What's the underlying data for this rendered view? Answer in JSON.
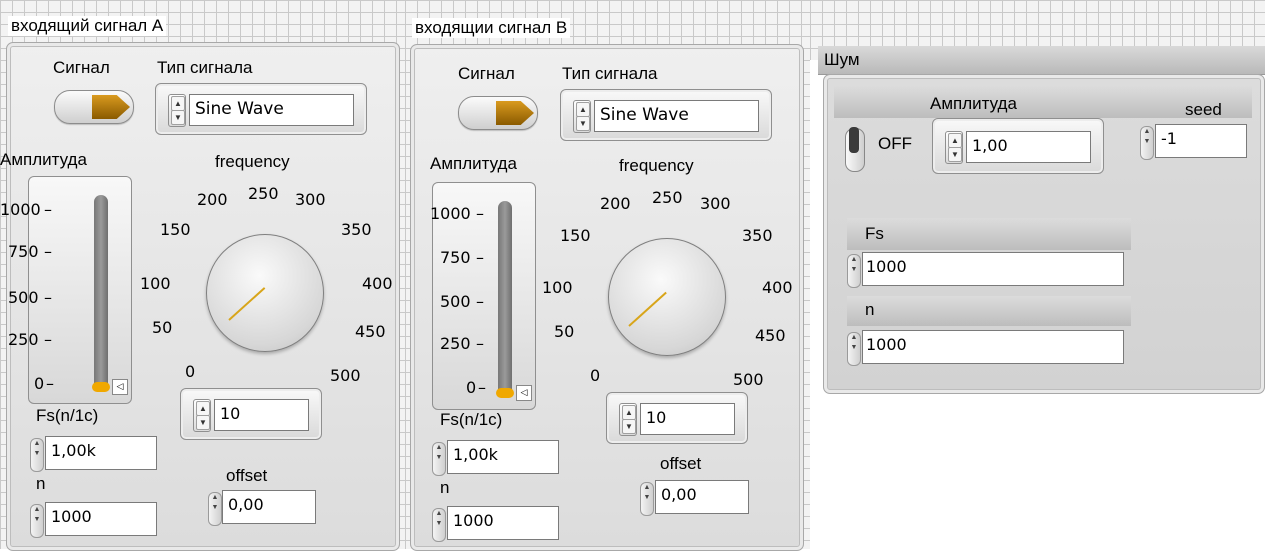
{
  "panel_a": {
    "title": "входящий сигнал A",
    "signal_label": "Сигнал",
    "signal_type_label": "Тип сигнала",
    "signal_type_value": "Sine Wave",
    "amplitude_label": "Амплитуда",
    "amplitude_ticks": [
      "1000",
      "750",
      "500",
      "250",
      "0"
    ],
    "amplitude_level": 0,
    "frequency_label": "frequency",
    "frequency_ticks": [
      "0",
      "50",
      "100",
      "150",
      "200",
      "250",
      "300",
      "350",
      "400",
      "450",
      "500"
    ],
    "frequency_value": "10",
    "fs_label": "Fs(n/1c)",
    "fs_value": "1,00k",
    "n_label": "n",
    "n_value": "1000",
    "offset_label": "offset",
    "offset_value": "0,00"
  },
  "panel_b": {
    "title": "входящии сигнал B",
    "signal_label": "Сигнал",
    "signal_type_label": "Тип сигнала",
    "signal_type_value": "Sine Wave",
    "amplitude_label": "Амплитуда",
    "amplitude_ticks": [
      "1000",
      "750",
      "500",
      "250",
      "0"
    ],
    "amplitude_level": 0,
    "frequency_label": "frequency",
    "frequency_ticks": [
      "0",
      "50",
      "100",
      "150",
      "200",
      "250",
      "300",
      "350",
      "400",
      "450",
      "500"
    ],
    "frequency_value": "10",
    "fs_label": "Fs(n/1c)",
    "fs_value": "1,00k",
    "n_label": "n",
    "n_value": "1000",
    "offset_label": "offset",
    "offset_value": "0,00"
  },
  "noise": {
    "title": "Шум",
    "switch_label": "OFF",
    "amplitude_label": "Амплитуда",
    "amplitude_value": "1,00",
    "seed_label": "seed",
    "seed_value": "-1",
    "fs_label": "Fs",
    "fs_value": "1000",
    "n_label": "n",
    "n_value": "1000"
  },
  "colors": {
    "accent": "#d8a51a",
    "panel": "#e3e3e3",
    "slider_fill": "#f0a800"
  }
}
